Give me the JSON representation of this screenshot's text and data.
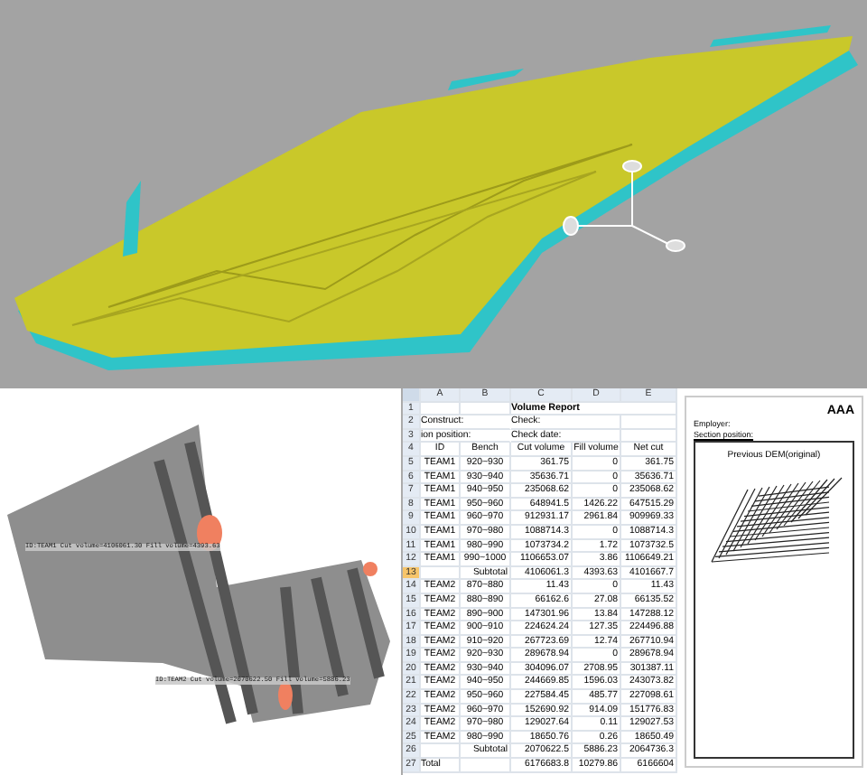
{
  "terrain_map": {
    "labels": [
      "ID:TEAM1 Cut volume=4106061.30 Fill volume=4393.63",
      "ID:TEAM2 Cut volume=2070622.50 Fill volume=5886.23"
    ]
  },
  "volume_report": {
    "columns": [
      "A",
      "B",
      "C",
      "D",
      "E"
    ],
    "rows": [
      {
        "number": "1",
        "selected": false,
        "kind": "title",
        "cells": [
          "",
          "",
          "Volume Report"
        ]
      },
      {
        "number": "2",
        "selected": false,
        "kind": "meta",
        "cells": [
          "Construct:",
          "",
          "Check:"
        ]
      },
      {
        "number": "3",
        "selected": false,
        "kind": "meta",
        "cells": [
          "ion position:",
          "",
          "Check date:"
        ]
      },
      {
        "number": "4",
        "selected": false,
        "kind": "header",
        "cells": [
          "ID",
          "Bench",
          "Cut volume",
          "Fill volume",
          "Net cut"
        ]
      },
      {
        "number": "5",
        "selected": false,
        "kind": "data",
        "cells": [
          "TEAM1",
          "920~930",
          "361.75",
          "0",
          "361.75"
        ]
      },
      {
        "number": "6",
        "selected": false,
        "kind": "data",
        "cells": [
          "TEAM1",
          "930~940",
          "35636.71",
          "0",
          "35636.71"
        ]
      },
      {
        "number": "7",
        "selected": false,
        "kind": "data",
        "cells": [
          "TEAM1",
          "940~950",
          "235068.62",
          "0",
          "235068.62"
        ]
      },
      {
        "number": "8",
        "selected": false,
        "kind": "data",
        "cells": [
          "TEAM1",
          "950~960",
          "648941.5",
          "1426.22",
          "647515.29"
        ]
      },
      {
        "number": "9",
        "selected": false,
        "kind": "data",
        "cells": [
          "TEAM1",
          "960~970",
          "912931.17",
          "2961.84",
          "909969.33"
        ]
      },
      {
        "number": "10",
        "selected": false,
        "kind": "data",
        "cells": [
          "TEAM1",
          "970~980",
          "1088714.3",
          "0",
          "1088714.3"
        ]
      },
      {
        "number": "11",
        "selected": false,
        "kind": "data",
        "cells": [
          "TEAM1",
          "980~990",
          "1073734.2",
          "1.72",
          "1073732.5"
        ]
      },
      {
        "number": "12",
        "selected": false,
        "kind": "data",
        "cells": [
          "TEAM1",
          "990~1000",
          "1106653.07",
          "3.86",
          "1106649.21"
        ]
      },
      {
        "number": "13",
        "selected": true,
        "kind": "subtotal",
        "cells": [
          "",
          "Subtotal",
          "4106061.3",
          "4393.63",
          "4101667.7"
        ]
      },
      {
        "number": "14",
        "selected": false,
        "kind": "data",
        "cells": [
          "TEAM2",
          "870~880",
          "11.43",
          "0",
          "11.43"
        ]
      },
      {
        "number": "15",
        "selected": false,
        "kind": "data",
        "cells": [
          "TEAM2",
          "880~890",
          "66162.6",
          "27.08",
          "66135.52"
        ]
      },
      {
        "number": "16",
        "selected": false,
        "kind": "data",
        "cells": [
          "TEAM2",
          "890~900",
          "147301.96",
          "13.84",
          "147288.12"
        ]
      },
      {
        "number": "17",
        "selected": false,
        "kind": "data",
        "cells": [
          "TEAM2",
          "900~910",
          "224624.24",
          "127.35",
          "224496.88"
        ]
      },
      {
        "number": "18",
        "selected": false,
        "kind": "data",
        "cells": [
          "TEAM2",
          "910~920",
          "267723.69",
          "12.74",
          "267710.94"
        ]
      },
      {
        "number": "19",
        "selected": false,
        "kind": "data",
        "cells": [
          "TEAM2",
          "920~930",
          "289678.94",
          "0",
          "289678.94"
        ]
      },
      {
        "number": "20",
        "selected": false,
        "kind": "data",
        "cells": [
          "TEAM2",
          "930~940",
          "304096.07",
          "2708.95",
          "301387.11"
        ]
      },
      {
        "number": "21",
        "selected": false,
        "kind": "data",
        "cells": [
          "TEAM2",
          "940~950",
          "244669.85",
          "1596.03",
          "243073.82"
        ]
      },
      {
        "number": "22",
        "selected": false,
        "kind": "data",
        "cells": [
          "TEAM2",
          "950~960",
          "227584.45",
          "485.77",
          "227098.61"
        ]
      },
      {
        "number": "23",
        "selected": false,
        "kind": "data",
        "cells": [
          "TEAM2",
          "960~970",
          "152690.92",
          "914.09",
          "151776.83"
        ]
      },
      {
        "number": "24",
        "selected": false,
        "kind": "data",
        "cells": [
          "TEAM2",
          "970~980",
          "129027.64",
          "0.11",
          "129027.53"
        ]
      },
      {
        "number": "25",
        "selected": false,
        "kind": "data",
        "cells": [
          "TEAM2",
          "980~990",
          "18650.76",
          "0.26",
          "18650.49"
        ]
      },
      {
        "number": "26",
        "selected": false,
        "kind": "subtotal",
        "cells": [
          "",
          "Subtotal",
          "2070622.5",
          "5886.23",
          "2064736.3"
        ]
      },
      {
        "number": "27",
        "selected": false,
        "kind": "total",
        "cells": [
          "Total",
          "",
          "6176683.8",
          "10279.86",
          "6166604"
        ]
      }
    ]
  },
  "report_page": {
    "company": "AAA",
    "employer": "Employer:",
    "section": "Section position:",
    "title": "Previous DEM(original)"
  }
}
